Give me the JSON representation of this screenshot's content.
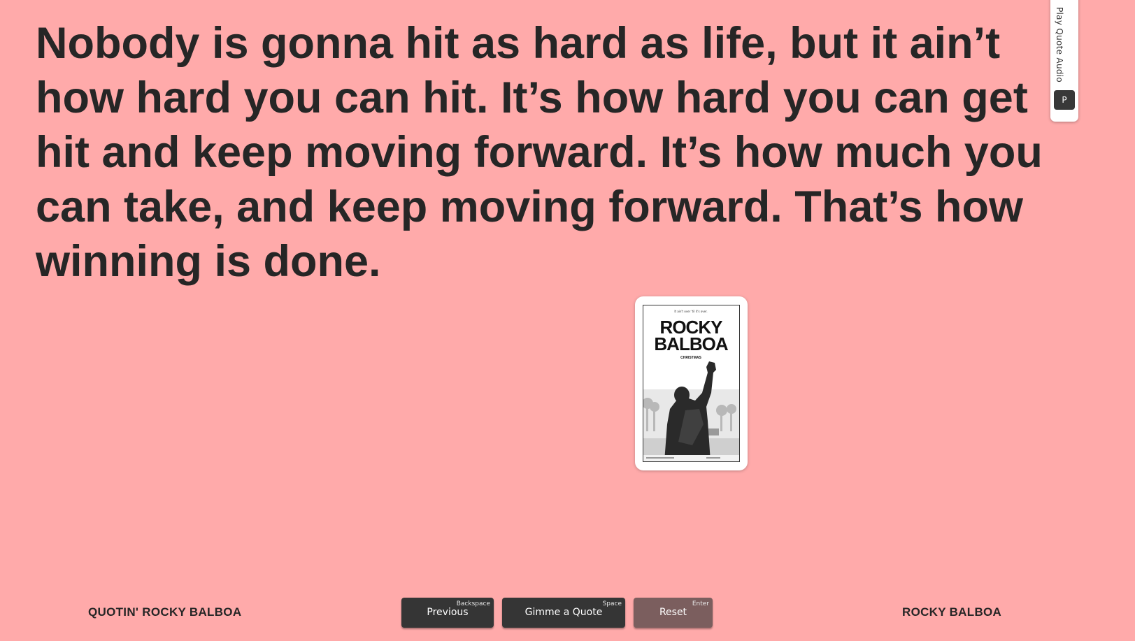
{
  "quote": {
    "text": "Nobody is gonna hit as hard as life, but it ain’t how hard you can hit. It’s how hard you can get hit and keep moving forward. It’s how much you can take, and keep moving forward. That’s how winning is done."
  },
  "poster": {
    "tagline": "It ain't over 'til it's over.",
    "title_line1": "ROCKY",
    "title_line2": "BALBOA",
    "subtitle": "CHRISTMAS"
  },
  "audio_tab": {
    "label": "Play Quote Audio",
    "key": "P"
  },
  "footer": {
    "left_title": "QUOTIN' ROCKY BALBOA",
    "right_title": "ROCKY BALBOA",
    "buttons": {
      "previous": {
        "label": "Previous",
        "key": "Backspace"
      },
      "quote": {
        "label": "Gimme a Quote",
        "key": "Space"
      },
      "reset": {
        "label": "Reset",
        "key": "Enter"
      }
    }
  },
  "colors": {
    "background": "#ffaaaa",
    "text": "#262626",
    "button": "#353535",
    "reset_button": "#7b5e5e"
  }
}
